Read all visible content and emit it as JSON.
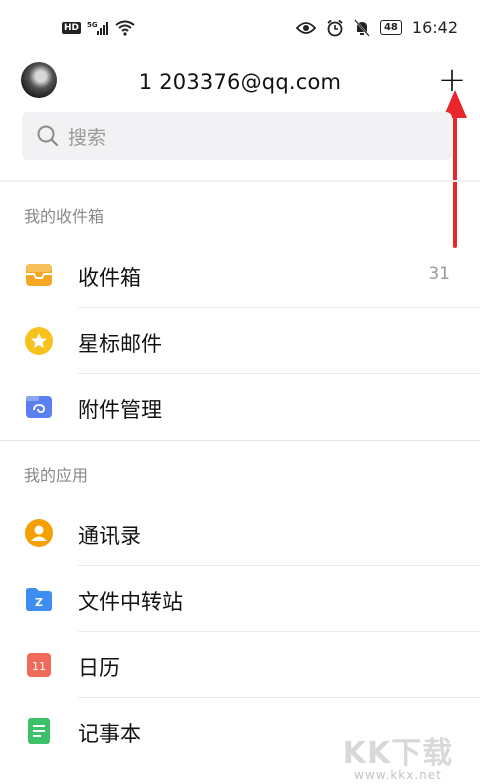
{
  "status_bar": {
    "hd": "HD",
    "network": "5G",
    "battery": "48",
    "time": "16:42"
  },
  "header": {
    "account": "1      203376@qq.com",
    "add_icon": "plus-icon"
  },
  "search": {
    "placeholder": "搜索"
  },
  "sections": {
    "mailbox_title": "我的收件箱",
    "apps_title": "我的应用"
  },
  "mailbox_items": [
    {
      "label": "收件箱",
      "count": "31",
      "icon": "inbox-icon",
      "color": "#f5a623"
    },
    {
      "label": "星标邮件",
      "icon": "star-icon",
      "color": "#f7c21b"
    },
    {
      "label": "附件管理",
      "icon": "attachment-icon",
      "color": "#5b7ff0"
    }
  ],
  "app_items": [
    {
      "label": "通讯录",
      "icon": "contacts-icon",
      "color": "#f5a000"
    },
    {
      "label": "文件中转站",
      "icon": "folder-icon",
      "color": "#3d8ef0"
    },
    {
      "label": "日历",
      "icon": "calendar-icon",
      "color": "#f06a5a",
      "day": "11"
    },
    {
      "label": "记事本",
      "icon": "notepad-icon",
      "color": "#3cc06a"
    }
  ],
  "watermark": {
    "big": "KK下载",
    "small": "www.kkx.net"
  }
}
